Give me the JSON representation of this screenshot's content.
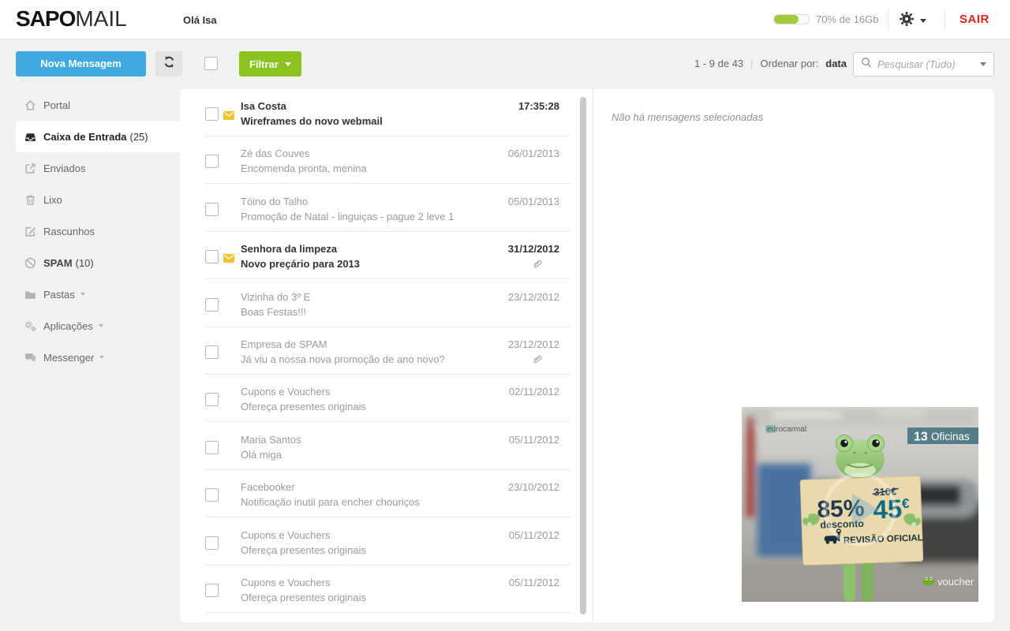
{
  "header": {
    "logo_primary": "SAPO",
    "logo_secondary": "MAIL",
    "greeting": "Olá Isa",
    "storage_text": "70% de 16Gb",
    "storage_percent": 70,
    "logout_label": "SAIR"
  },
  "toolbar": {
    "compose_label": "Nova Mensagem",
    "filter_label": "Filtrar",
    "range_text": "1 - 9 de 43",
    "separator": "|",
    "sort_label": "Ordenar por:",
    "sort_value": "data",
    "search_placeholder": "Pesquisar (Tudo)"
  },
  "sidebar": {
    "items": [
      {
        "label": "Portal",
        "icon": "home-icon"
      },
      {
        "label": "Caixa de Entrada",
        "count": "(25)",
        "icon": "inbox-icon",
        "active": true
      },
      {
        "label": "Enviados",
        "icon": "sent-icon"
      },
      {
        "label": "Lixo",
        "icon": "trash-icon"
      },
      {
        "label": "Rascunhos",
        "icon": "drafts-icon"
      },
      {
        "label": "SPAM",
        "count": "(10)",
        "icon": "spam-icon",
        "bold": true
      },
      {
        "label": "Pastas",
        "icon": "folder-icon",
        "expandable": true
      },
      {
        "label": "Aplicações",
        "icon": "apps-icon",
        "expandable": true
      },
      {
        "label": "Messenger",
        "icon": "messenger-icon",
        "expandable": true
      }
    ]
  },
  "message_list": {
    "messages": [
      {
        "sender": "Isa Costa",
        "subject": "Wireframes do novo webmail",
        "date": "17:35:28",
        "unread": true,
        "attachment": false
      },
      {
        "sender": "Zé das Couves",
        "subject": "Encomenda pronta, menina",
        "date": "06/01/2013",
        "unread": false,
        "attachment": false
      },
      {
        "sender": "Tóino do Talho",
        "subject": "Promoção de Natal - linguiças - pague 2 leve 1",
        "date": "05/01/2013",
        "unread": false,
        "attachment": false
      },
      {
        "sender": "Senhora da limpeza",
        "subject": "Novo preçário para 2013",
        "date": "31/12/2012",
        "unread": true,
        "attachment": true
      },
      {
        "sender": "Vizinha do 3º E",
        "subject": "Boas Festas!!!",
        "date": "23/12/2012",
        "unread": false,
        "attachment": false
      },
      {
        "sender": "Empresa de SPAM",
        "subject": "Já viu a nossa nova promoção de ano novo?",
        "date": "23/12/2012",
        "unread": false,
        "attachment": true
      },
      {
        "sender": "Cupons e Vouchers",
        "subject": "Ofereça presentes originais",
        "date": "02/11/2012",
        "unread": false,
        "attachment": false
      },
      {
        "sender": "Maria Santos",
        "subject": "Olá miga",
        "date": "05/11/2012",
        "unread": false,
        "attachment": false
      },
      {
        "sender": "Facebooker",
        "subject": "Notificação inutil para encher chouriços",
        "date": "23/10/2012",
        "unread": false,
        "attachment": false
      },
      {
        "sender": "Cupons e Vouchers",
        "subject": "Ofereça presentes originais",
        "date": "05/11/2012",
        "unread": false,
        "attachment": false
      },
      {
        "sender": "Cupons e Vouchers",
        "subject": "Ofereça presentes originais",
        "date": "05/11/2012",
        "unread": false,
        "attachment": false
      }
    ]
  },
  "reading_pane": {
    "empty_text": "Não há mensagens selecionadas"
  },
  "ad": {
    "advertiser": "eurocarmat",
    "badge_number": "13",
    "badge_label": "Oficinas",
    "discount_value": "85%",
    "discount_label": "desconto",
    "old_price": "310€",
    "new_price": "45",
    "currency": "€",
    "service_label": "REVISÃO OFICIAL",
    "brand": "voucher"
  },
  "colors": {
    "accent_blue": "#3fa9e0",
    "accent_green": "#8cc21d",
    "logout_red": "#d6271f",
    "storage_fill": "#a3c93c",
    "unread_envelope": "#eec435",
    "badge_teal": "#4b7683"
  }
}
